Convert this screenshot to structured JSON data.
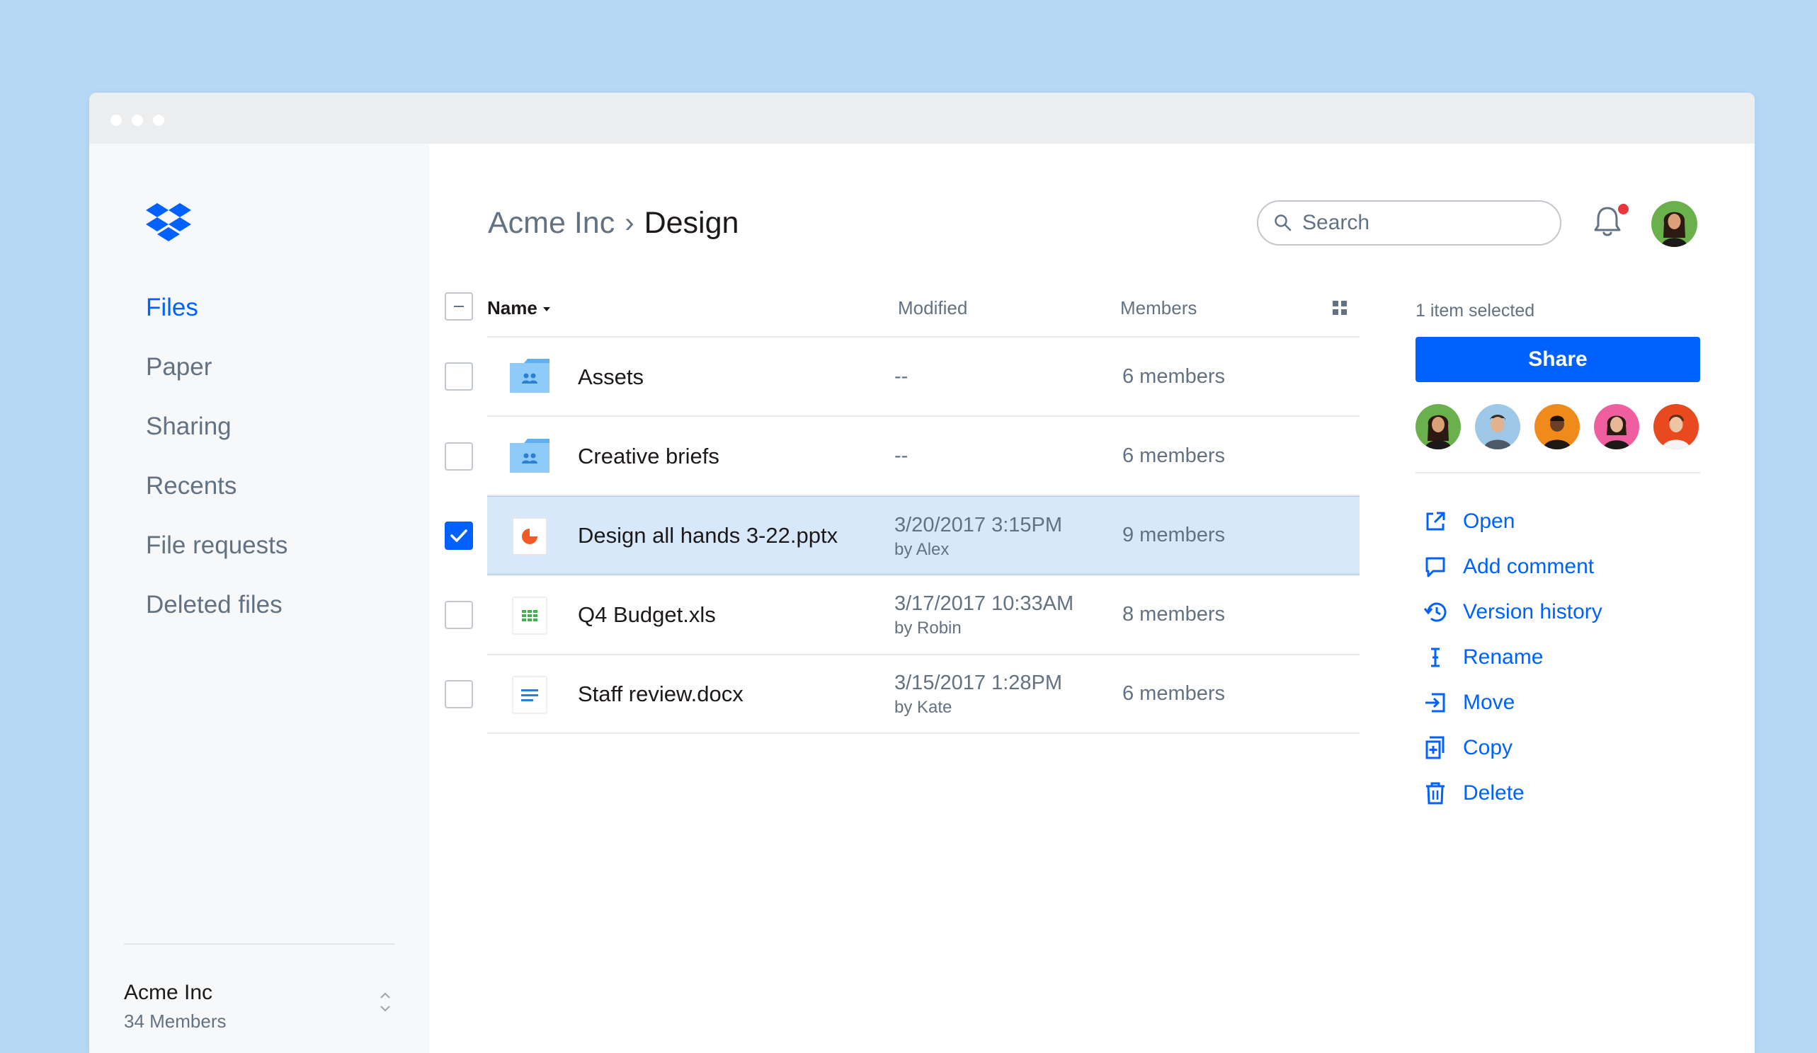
{
  "sidebar": {
    "nav": [
      "Files",
      "Paper",
      "Sharing",
      "Recents",
      "File requests",
      "Deleted files"
    ],
    "active_index": 0,
    "team": {
      "name": "Acme Inc",
      "members": "34 Members"
    }
  },
  "header": {
    "breadcrumb_parent": "Acme Inc",
    "breadcrumb_separator": "›",
    "breadcrumb_current": "Design",
    "search_placeholder": "Search"
  },
  "table": {
    "columns": {
      "name": "Name",
      "modified": "Modified",
      "members": "Members"
    },
    "rows": [
      {
        "name": "Assets",
        "icon": "shared-folder-icon",
        "modified": "--",
        "by": "",
        "members": "6 members",
        "selected": false
      },
      {
        "name": "Creative briefs",
        "icon": "shared-folder-icon",
        "modified": "--",
        "by": "",
        "members": "6 members",
        "selected": false
      },
      {
        "name": "Design all hands 3-22.pptx",
        "icon": "presentation-file-icon",
        "modified": "3/20/2017 3:15PM",
        "by": "by Alex",
        "members": "9 members",
        "selected": true
      },
      {
        "name": "Q4 Budget.xls",
        "icon": "spreadsheet-file-icon",
        "modified": "3/17/2017 10:33AM",
        "by": "by Robin",
        "members": "8 members",
        "selected": false
      },
      {
        "name": "Staff review.docx",
        "icon": "document-file-icon",
        "modified": "3/15/2017 1:28PM",
        "by": "by Kate",
        "members": "6 members",
        "selected": false
      }
    ]
  },
  "panel": {
    "selected_count": "1 item selected",
    "share_label": "Share",
    "actions": [
      "Open",
      "Add comment",
      "Version history",
      "Rename",
      "Move",
      "Copy",
      "Delete"
    ]
  },
  "colors": {
    "accent": "#0061fe",
    "background": "#b5d8f5",
    "selected_row": "#d8e8fb",
    "notification": "#e5373c",
    "folder": "#7fc2f7"
  }
}
